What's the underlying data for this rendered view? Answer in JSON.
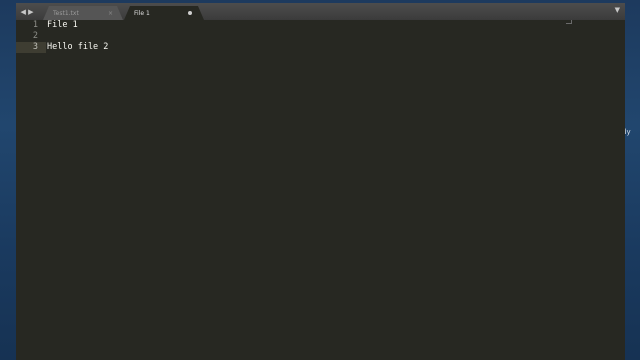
{
  "window": {
    "tabs": [
      {
        "label": "Test1.txt",
        "close": "×",
        "active": false
      },
      {
        "label": "File 1",
        "active": true,
        "dirty": true
      }
    ],
    "nav_arrows": "◀ ▶",
    "dropdown": "▼"
  },
  "editor": {
    "lines": [
      {
        "number": "1",
        "text": "File 1"
      },
      {
        "number": "2",
        "text": ""
      },
      {
        "number": "3",
        "text": "Hello file 2"
      }
    ],
    "current_line": 3
  },
  "desktop": {
    "edge_text": "dy"
  }
}
